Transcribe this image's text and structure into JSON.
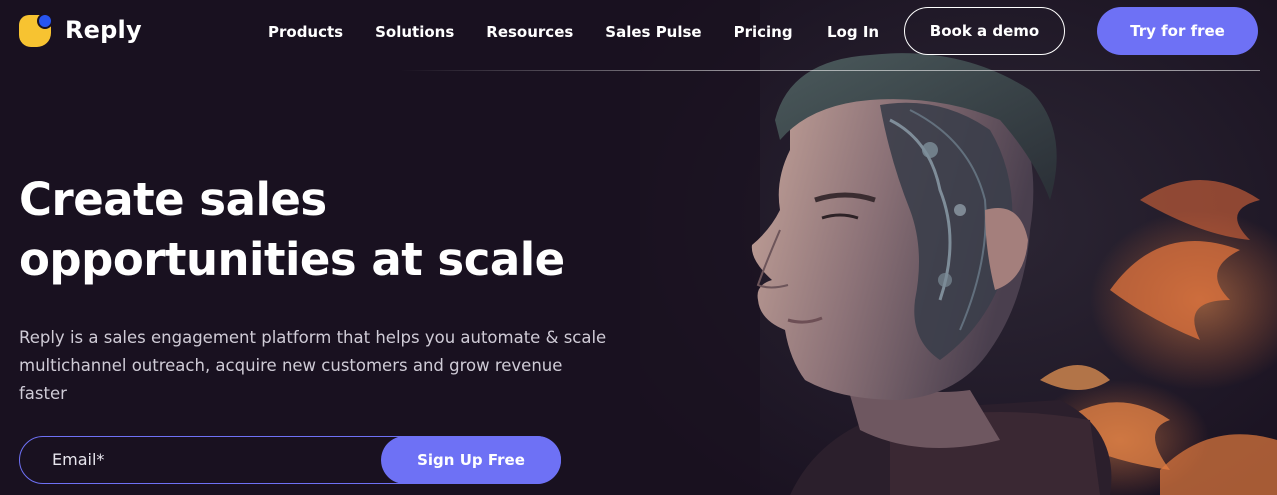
{
  "brand": {
    "name": "Reply",
    "mark_color": "#f7c331",
    "dot_color": "#2855f0"
  },
  "nav": {
    "items": [
      {
        "label": "Products"
      },
      {
        "label": "Solutions"
      },
      {
        "label": "Resources"
      },
      {
        "label": "Sales Pulse"
      },
      {
        "label": "Pricing"
      }
    ],
    "login_label": "Log In",
    "demo_label": "Book a demo",
    "try_label": "Try for free"
  },
  "hero": {
    "headline": "Create sales opportunities at scale",
    "subtext": "Reply is a sales engagement platform that helps you automate & scale multichannel outreach, acquire new customers and grow revenue faster",
    "email_placeholder": "Email*",
    "signup_label": "Sign Up Free",
    "image": "man-with-cybernetic-face-illustration"
  },
  "colors": {
    "background": "#191120",
    "accent": "#6e71f5"
  }
}
